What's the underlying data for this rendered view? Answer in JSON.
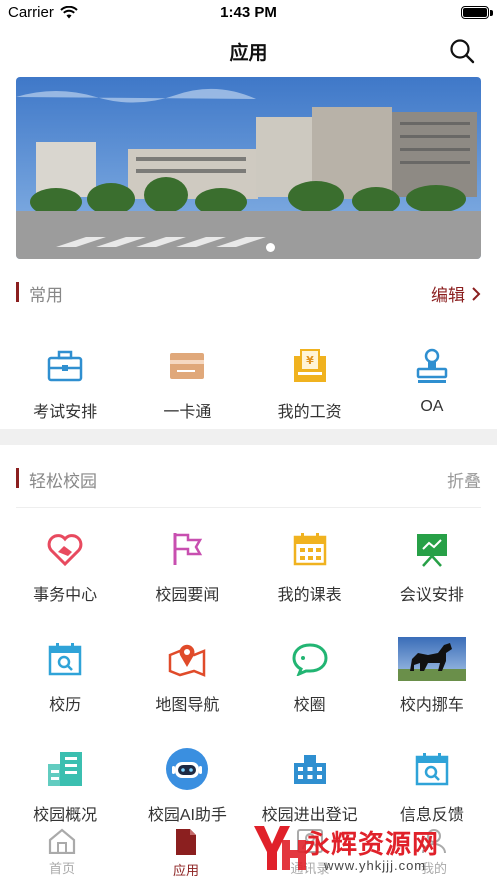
{
  "status_bar": {
    "carrier": "Carrier",
    "time": "1:43 PM"
  },
  "nav": {
    "title": "应用"
  },
  "common": {
    "title": "常用",
    "action": "编辑",
    "items": [
      {
        "label": "考试安排",
        "icon": "briefcase-icon",
        "color": "#2f8fd0"
      },
      {
        "label": "一卡通",
        "icon": "card-icon",
        "color": "#e0a87a"
      },
      {
        "label": "我的工资",
        "icon": "salary-icon",
        "color": "#f0b21f"
      },
      {
        "label": "OA",
        "icon": "stamp-icon",
        "color": "#2f8fd0"
      }
    ]
  },
  "campus": {
    "title": "轻松校园",
    "action": "折叠",
    "items": [
      {
        "label": "事务中心",
        "icon": "heart-hand-icon",
        "color": "#e84a5f"
      },
      {
        "label": "校园要闻",
        "icon": "flag-icon",
        "color": "#c84fb0"
      },
      {
        "label": "我的课表",
        "icon": "calendar-grid-icon",
        "color": "#f0b21f"
      },
      {
        "label": "会议安排",
        "icon": "presentation-icon",
        "color": "#27a047"
      },
      {
        "label": "校历",
        "icon": "calendar-search-icon",
        "color": "#2fa3d8"
      },
      {
        "label": "地图导航",
        "icon": "map-pin-icon",
        "color": "#e04b2a"
      },
      {
        "label": "校圈",
        "icon": "chat-bubble-icon",
        "color": "#22b573"
      },
      {
        "label": "校内挪车",
        "icon": "horse-photo-icon",
        "color": "#3a6db8"
      },
      {
        "label": "校园概况",
        "icon": "building-icon",
        "color": "#3bbfb0"
      },
      {
        "label": "校园AI助手",
        "icon": "robot-icon",
        "color": "#3a8fe0"
      },
      {
        "label": "校园进出登记",
        "icon": "register-building-icon",
        "color": "#2f8fd0"
      },
      {
        "label": "信息反馈",
        "icon": "feedback-calendar-icon",
        "color": "#2fa3d8"
      }
    ]
  },
  "tabs": [
    {
      "label": "首页",
      "icon": "home-icon",
      "active": false
    },
    {
      "label": "应用",
      "icon": "apps-icon",
      "active": true
    },
    {
      "label": "通讯录",
      "icon": "contacts-icon",
      "active": false
    },
    {
      "label": "我的",
      "icon": "profile-icon",
      "active": false
    }
  ],
  "watermark": {
    "text": "永辉资源网",
    "url": "www.yhkjjj.com"
  },
  "colors": {
    "accent": "#8b1f1f",
    "divider": "#f0f0f0"
  }
}
